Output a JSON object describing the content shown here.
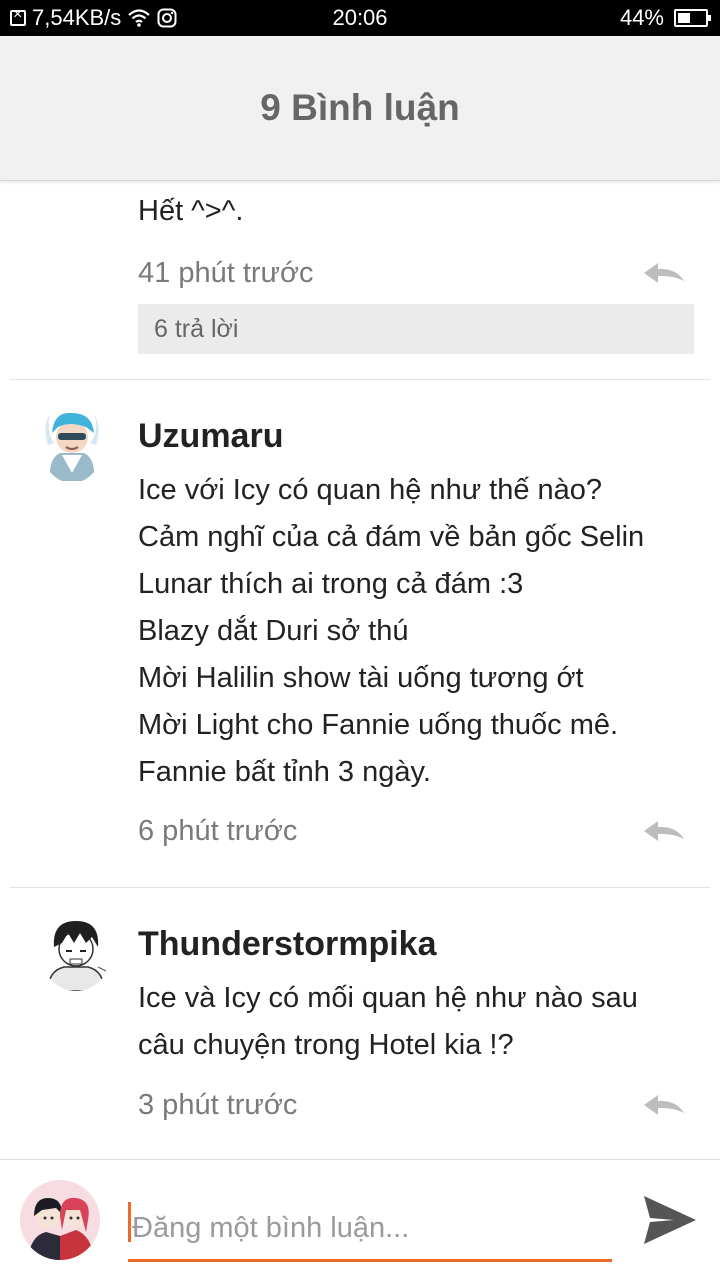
{
  "status_bar": {
    "speed": "7,54KB/s",
    "time": "20:06",
    "battery": "44%",
    "battery_level": 0.44,
    "icons": [
      "notification-box-icon",
      "wifi-icon",
      "instagram-icon",
      "battery-icon"
    ]
  },
  "header": {
    "title": "9 Bình luận"
  },
  "comments": [
    {
      "partial_text": "Hết ^>^.",
      "time": "41 phút trước",
      "replies": "6 trả lời",
      "icon": "reply-icon"
    },
    {
      "username": "Uzumaru",
      "lines": [
        "Ice với Icy có quan hệ như thế nào?",
        "Cảm nghĩ của cả đám về bản gốc Selin",
        "Lunar thích ai trong cả đám :3",
        "Blazy dắt Duri sở thú",
        "Mời Halilin show tài uống tương ớt",
        "Mời Light cho Fannie uống thuốc mê.",
        "Fannie bất tỉnh 3 ngày."
      ],
      "time": "6 phút trước",
      "icon": "reply-icon"
    },
    {
      "username": "Thunderstormpika",
      "lines": [
        "Ice và Icy có mối quan hệ như nào sau",
        "câu chuyện trong Hotel kia !?"
      ],
      "time": "3 phút trước",
      "icon": "reply-icon"
    }
  ],
  "composer": {
    "placeholder": "Đăng một bình luận...",
    "value": "",
    "send_icon": "send-icon"
  },
  "colors": {
    "accent": "#ee6a2a",
    "header_bg": "#f1f1f1",
    "muted_text": "#7a7a7a"
  }
}
